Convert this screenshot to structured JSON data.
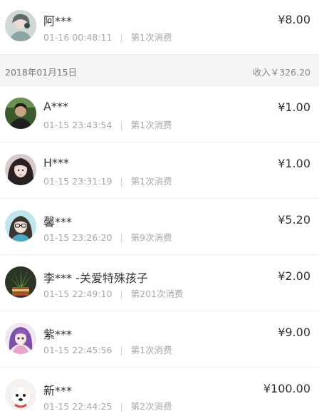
{
  "top_entry": {
    "name": "阿***",
    "time": "01-16 00:48:11",
    "order": "第1次消费",
    "amount": "¥8.00",
    "avatar_icon": "avatar-girl-icon"
  },
  "day_group": {
    "date": "2018年01月15日",
    "income": "收入￥326.20"
  },
  "entries": [
    {
      "name": "A***",
      "time": "01-15 23:43:54",
      "order": "第1次消费",
      "amount": "¥1.00",
      "avatar_icon": "avatar-man-icon"
    },
    {
      "name": "H***",
      "time": "01-15 23:31:19",
      "order": "第1次消费",
      "amount": "¥1.00",
      "avatar_icon": "avatar-girl-icon"
    },
    {
      "name": "馨***",
      "time": "01-15 23:26:20",
      "order": "第9次消费",
      "amount": "¥5.20",
      "avatar_icon": "avatar-girl-glasses-icon"
    },
    {
      "name": "李*** -关爱特殊孩子",
      "time": "01-15 22:49:10",
      "order": "第201次消费",
      "amount": "¥2.00",
      "avatar_icon": "avatar-plant-icon"
    },
    {
      "name": "紫***",
      "time": "01-15 22:45:56",
      "order": "第1次消费",
      "amount": "¥9.00",
      "avatar_icon": "avatar-anime-icon"
    },
    {
      "name": "新***",
      "time": "01-15 22:44:25",
      "order": "第2次消费",
      "amount": "¥100.00",
      "avatar_icon": "avatar-puppy-icon"
    }
  ]
}
